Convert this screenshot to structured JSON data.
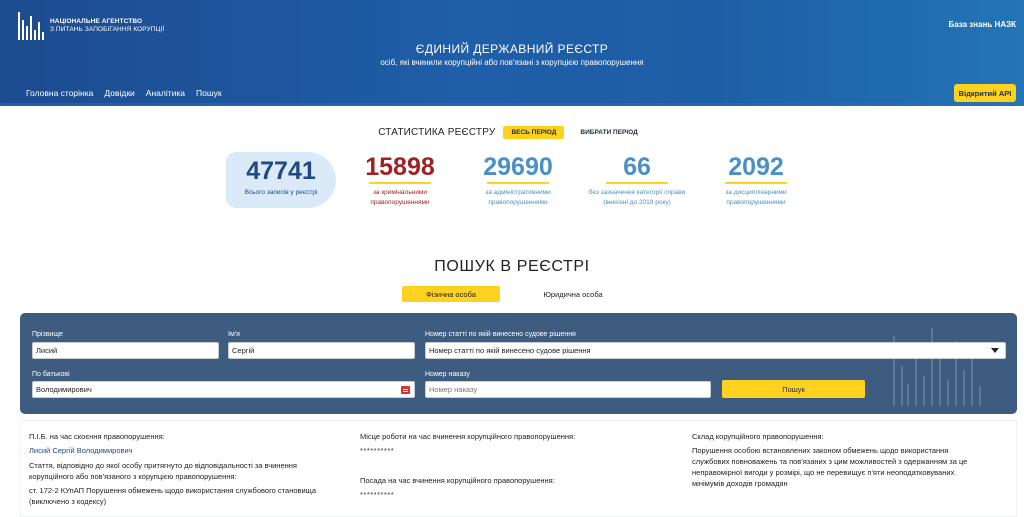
{
  "header": {
    "logo_line1": "НАЦІОНАЛЬНЕ АГЕНТСТВО",
    "logo_line2": "З ПИТАНЬ ЗАПОБІГАННЯ КОРУПЦІЇ",
    "kb_link": "База знань НАЗК",
    "title": "ЄДИНИЙ ДЕРЖАВНИЙ РЕЄСТР",
    "subtitle": "осіб, які вчинили корупційні або пов'язані з корупцією правопорушення",
    "nav": [
      "Головна сторінка",
      "Довідки",
      "Аналітика",
      "Пошук"
    ],
    "api_button": "Відкритий API",
    "bg_color": "#1f5ea8"
  },
  "stats": {
    "title": "СТАТИСТИКА РЕЄСТРУ",
    "period_all": "ВЕСЬ ПЕРІОД",
    "period_choose": "ВИБРАТИ ПЕРІОД",
    "total": {
      "value": "47741",
      "label": "Всього записів у реєстрі"
    },
    "criminal": {
      "value": "15898",
      "label1": "за кримінальними",
      "label2": "правопорушеннями"
    },
    "administrative": {
      "value": "29690",
      "label1": "за адміністративними",
      "label2": "правопорушеннями"
    },
    "no_category": {
      "value": "66",
      "label1": "без зазначення категорії справи",
      "label2": "(внесені до 2019 року)"
    },
    "disciplinary": {
      "value": "2092",
      "label1": "за дисциплінарними",
      "label2": "правопорушеннями"
    }
  },
  "search": {
    "title": "ПОШУК В РЕЄСТРІ",
    "tab_person": "Фізична особа",
    "tab_legal": "Юридична особа",
    "surname_label": "Прізвище",
    "surname_value": "Лисий",
    "name_label": "Ім'я",
    "name_value": "Сергій",
    "article_label": "Номер статті по якій винесено судове рішення",
    "article_value": "Номер статті по якій винесено судове рішення",
    "patronymic_label": "По батькові",
    "patronymic_value": "Володимирович",
    "order_label": "Номер наказу",
    "order_placeholder": "Номер наказу",
    "search_button": "Пошук",
    "panel_color": "#3e5b80",
    "accent": "#ffd21f"
  },
  "result": {
    "fio_label": "П.І.Б. на час скоєння правопорушення:",
    "fio_value": "Лисий Сергій Володимирович",
    "article_label_1": "Стаття, відповідно до якої особу притягнуто до відповідальності за вчинення",
    "article_label_2": "корупційного або пов'язаного з корупцією правопорушення:",
    "article_value_1": "ст. 172-2 КУпАП Порушення обмежень щодо використання службового становища",
    "article_value_2": "(виключено з кодексу)",
    "workplace_label": "Місце роботи на час вчинення корупційного правопорушення:",
    "workplace_value": "**********",
    "position_label": "Посада на час вчинення корупційного правопорушення:",
    "position_value": "**********",
    "composition_label": "Склад корупційного правопорушення:",
    "composition_1": "Порушення особою встановлених законом обмежень щодо використання",
    "composition_2": "службових повноважень та пов'язаних з цим можливостей з одержанням за це",
    "composition_3": "неправомірної вигоди у розмірі, що не перевищує п'яти неоподатковуваних",
    "composition_4": "мінімумів доходів громадян"
  }
}
